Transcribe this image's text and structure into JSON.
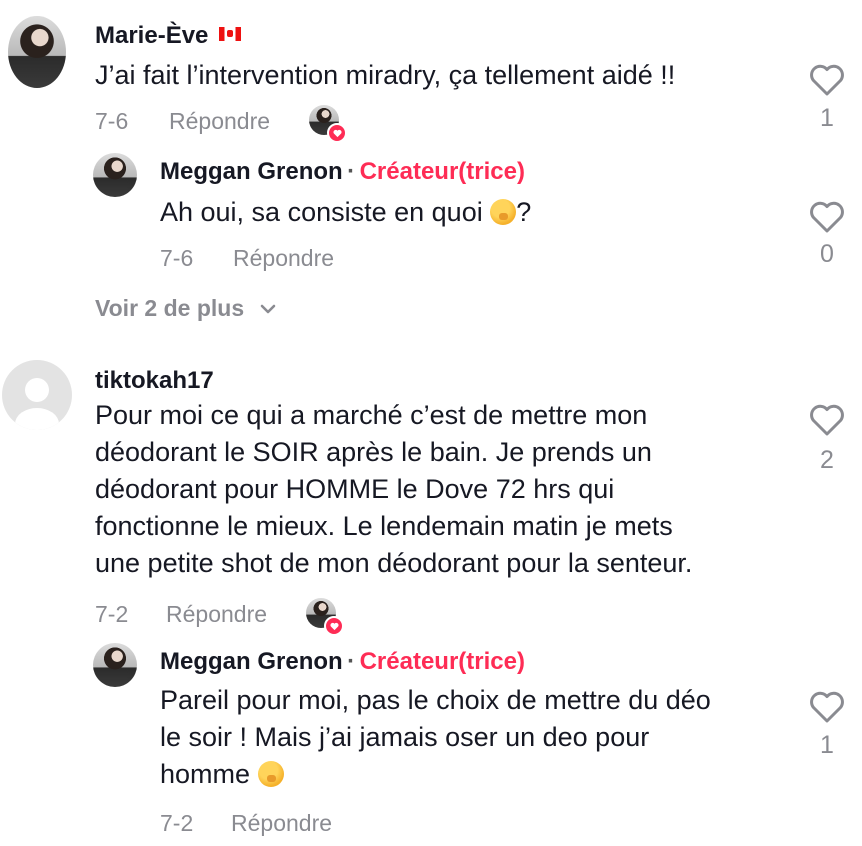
{
  "comments": [
    {
      "username": "Marie-Ève",
      "flag": "🇨🇦",
      "text": "J’ai fait l’intervention miradry, ça tellement aidé !!",
      "date": "7-6",
      "reply_label": "Répondre",
      "likes": "1",
      "reply": {
        "username": "Meggan Grenon",
        "separator": "·",
        "creator_label": "Créateur(trice)",
        "text_before": "Ah oui, sa consiste en quoi ",
        "text_after": "?",
        "date": "7-6",
        "reply_label": "Répondre",
        "likes": "0"
      },
      "more_label": "Voir 2 de plus"
    },
    {
      "username": "tiktokah17",
      "lines": [
        "Pour moi ce qui a marché c’est de mettre mon",
        "déodorant le SOIR après le bain. Je prends un",
        "déodorant pour HOMME le Dove 72 hrs qui",
        "fonctionne le mieux. Le lendemain matin je mets",
        "une petite shot de mon déodorant pour la senteur."
      ],
      "date": "7-2",
      "reply_label": "Répondre",
      "likes": "2",
      "reply": {
        "username": "Meggan Grenon",
        "separator": "·",
        "creator_label": "Créateur(trice)",
        "lines": [
          "Pareil pour moi, pas le choix de mettre du déo",
          "le soir ! Mais j’ai jamais oser un deo pour"
        ],
        "last_line_before": "homme ",
        "date": "7-2",
        "reply_label": "Répondre",
        "likes": "1"
      }
    }
  ],
  "colors": {
    "accent": "#fe2c55",
    "muted": "#8a8b91",
    "text": "#161823"
  },
  "icons": [
    "heart-outline-icon",
    "chevron-down-icon",
    "creator-liked-badge-icon",
    "shushing-face-emoji",
    "default-avatar-icon",
    "canada-flag-icon"
  ]
}
